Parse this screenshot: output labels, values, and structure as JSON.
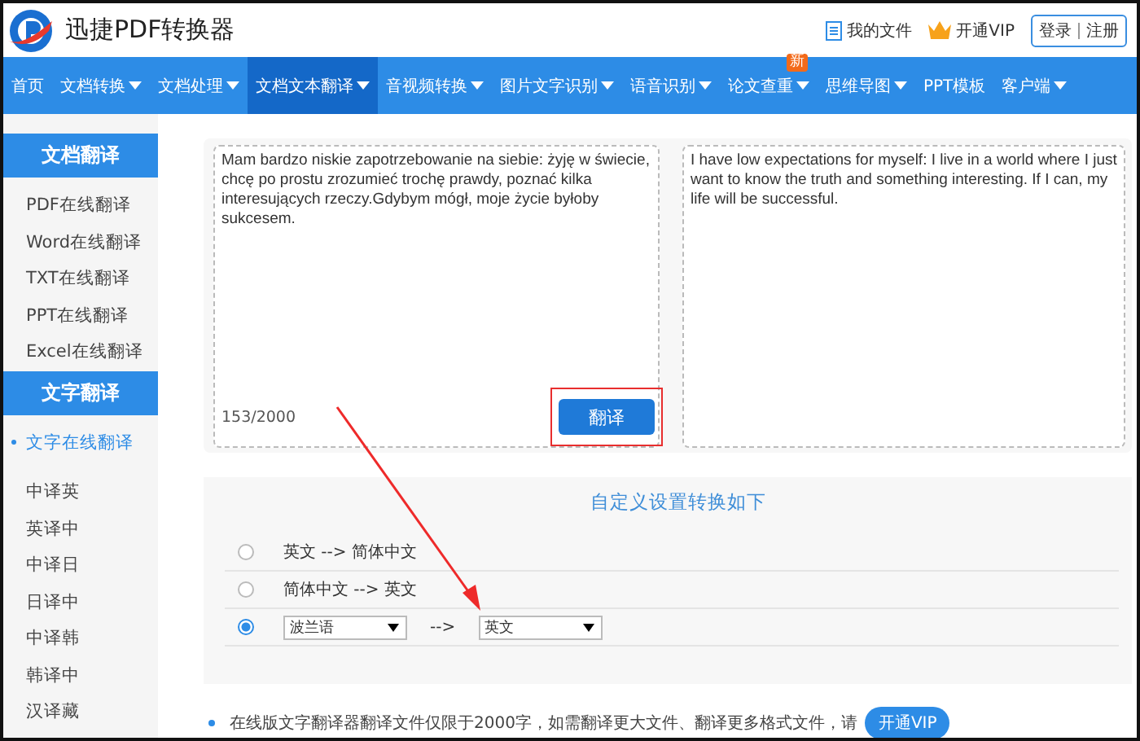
{
  "header": {
    "brand": "迅捷PDF转换器",
    "links": [
      {
        "kind": "files",
        "label": "我的文件"
      },
      {
        "kind": "vip",
        "label": "开通VIP"
      }
    ],
    "login": "登录",
    "register": "注册"
  },
  "nav": [
    {
      "label": "首页",
      "dropdown": false,
      "selected": false
    },
    {
      "label": "文档转换",
      "dropdown": true,
      "selected": false
    },
    {
      "label": "文档处理",
      "dropdown": true,
      "selected": false
    },
    {
      "label": "文档文本翻译",
      "dropdown": true,
      "selected": true
    },
    {
      "label": "音视频转换",
      "dropdown": true,
      "selected": false
    },
    {
      "label": "图片文字识别",
      "dropdown": true,
      "selected": false
    },
    {
      "label": "语音识别",
      "dropdown": true,
      "selected": false
    },
    {
      "label": "论文查重",
      "dropdown": true,
      "selected": false,
      "badge": "新"
    },
    {
      "label": "思维导图",
      "dropdown": true,
      "selected": false
    },
    {
      "label": "PPT模板",
      "dropdown": false,
      "selected": false
    },
    {
      "label": "客户端",
      "dropdown": true,
      "selected": false
    }
  ],
  "sidebar": [
    {
      "title": "文档翻译",
      "items": [
        {
          "label": "PDF在线翻译",
          "selected": false
        },
        {
          "label": "Word在线翻译",
          "selected": false
        },
        {
          "label": "TXT在线翻译",
          "selected": false
        },
        {
          "label": "PPT在线翻译",
          "selected": false
        },
        {
          "label": "Excel在线翻译",
          "selected": false
        }
      ]
    },
    {
      "title": "文字翻译",
      "items": [
        {
          "label": "文字在线翻译",
          "selected": true
        },
        {
          "label": "中译英",
          "selected": false
        },
        {
          "label": "英译中",
          "selected": false
        },
        {
          "label": "中译日",
          "selected": false
        },
        {
          "label": "日译中",
          "selected": false
        },
        {
          "label": "中译韩",
          "selected": false
        },
        {
          "label": "韩译中",
          "selected": false
        },
        {
          "label": "汉译藏",
          "selected": false
        }
      ]
    }
  ],
  "source": {
    "value": "Mam bardzo niskie zapotrzebowanie na siebie: żyję w świecie, chcę po prostu zrozumieć trochę prawdy, poznać kilka interesujących rzeczy.Gdybym mógł, moje życie byłoby sukcesem.",
    "count": "153/2000"
  },
  "translate_button": "翻译",
  "target": {
    "value": "I have low expectations for myself: I live in a world where I just want to know the truth and something interesting. If I can, my life will be successful."
  },
  "options": {
    "title": "自定义设置转换如下",
    "rows": [
      {
        "kind": "text",
        "label": "英文 --> 简体中文",
        "selected": false
      },
      {
        "kind": "text",
        "label": "简体中文 --> 英文",
        "selected": false
      },
      {
        "kind": "selects",
        "from": "波兰语",
        "arrow": "-->",
        "to": "英文",
        "selected": true
      }
    ]
  },
  "note": {
    "text": "在线版文字翻译器翻译文件仅限于2000字，如需翻译更大文件、翻译更多格式文件，请",
    "button": "开通VIP"
  }
}
